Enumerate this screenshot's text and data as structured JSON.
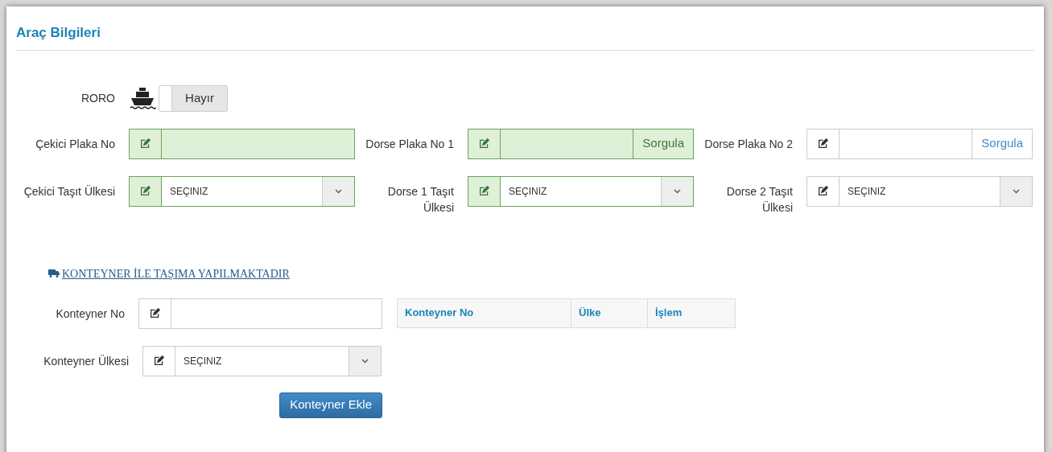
{
  "panel": {
    "title": "Araç Bilgileri"
  },
  "roro": {
    "label": "RORO",
    "on": false,
    "value_text": "Hayır"
  },
  "fields": [
    {
      "label": "Çekici Plaka No",
      "kind": "text",
      "valid": true
    },
    {
      "label": "Dorse Plaka No 1",
      "kind": "text",
      "valid": true,
      "button": "Sorgula"
    },
    {
      "label": "Dorse Plaka No 2",
      "kind": "text",
      "valid": false,
      "button": "Sorgula"
    },
    {
      "label": "Çekici Taşıt Ülkesi",
      "kind": "select",
      "valid": true,
      "value": "SEÇINIZ"
    },
    {
      "label": "Dorse 1 Taşıt Ülkesi",
      "kind": "select",
      "valid": true,
      "value": "SEÇINIZ"
    },
    {
      "label": "Dorse 2 Taşıt Ülkesi",
      "kind": "select",
      "valid": false,
      "value": "SEÇINIZ"
    }
  ],
  "container_link": "KONTEYNER İLE TAŞIMA YAPILMAKTADIR",
  "container_fields": [
    {
      "label": "Konteyner No",
      "kind": "text",
      "valid": false
    },
    {
      "label": "Konteyner Ülkesi",
      "kind": "select",
      "valid": false,
      "value": "SEÇINIZ"
    }
  ],
  "add_button": "Konteyner Ekle",
  "table": {
    "columns": [
      "Konteyner No",
      "Ülke",
      "İşlem"
    ]
  }
}
